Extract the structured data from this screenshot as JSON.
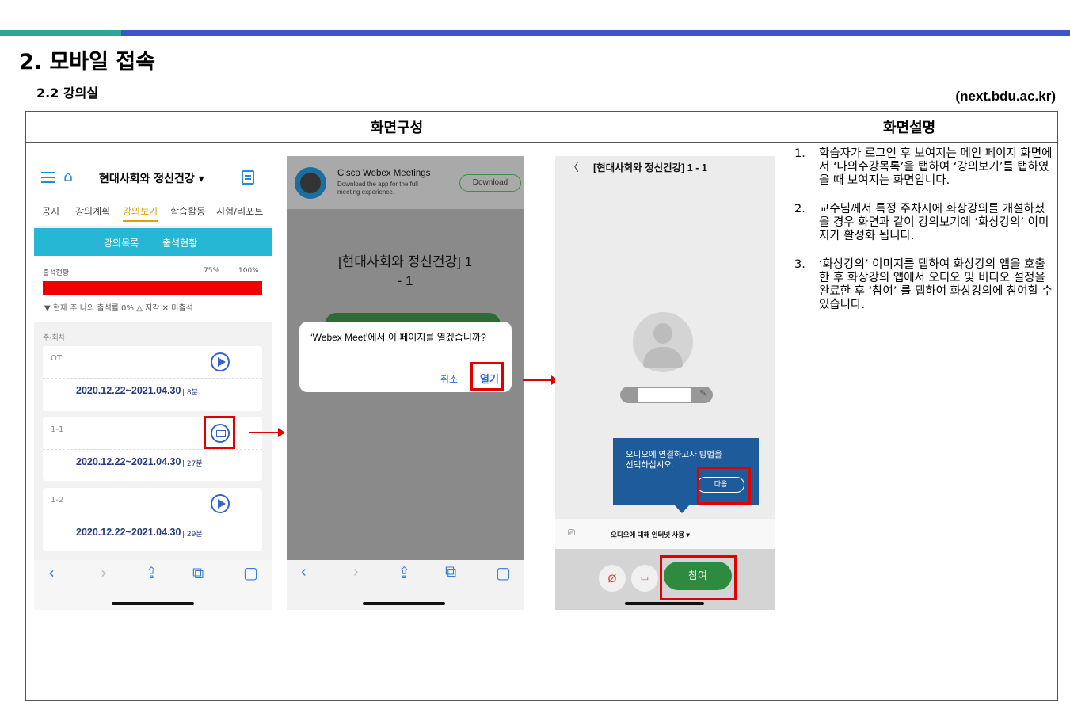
{
  "header": {
    "title": "2. 모바일 접속",
    "subtitle": "2.2 강의실",
    "url": "(next.bdu.ac.kr)"
  },
  "table": {
    "col1_header": "화면구성",
    "col2_header": "화면설명"
  },
  "description": [
    {
      "num": "1.",
      "text": "학습자가 로그인 후 보여지는 메인 페이지 화면에서 ‘나의수강목록’을 탭하여 ‘강의보기’를 탭하였을 때 보여지는 화면입니다."
    },
    {
      "num": "2.",
      "text": "교수님께서 특정 주차시에 화상강의를 개설하셨을 경우 화면과 같이 강의보기에 ‘화상강의’ 이미지가 활성화 됩니다."
    },
    {
      "num": "3.",
      "text": "‘화상강의’ 이미지를 탭하여 화상강의 앱을 호출한 후 화상강의 앱에서 오디오 및 비디오 설정을 완료한 후 ‘참여’ 를 탭하여 화상강의에 참여할 수 있습니다."
    }
  ],
  "phone1": {
    "course": "현대사회와 정신건강 ▾",
    "tabs": [
      "공지",
      "강의계획",
      "강의보기",
      "학습활동",
      "시험/리포트"
    ],
    "active_tab": "강의보기",
    "subtabs": [
      "강의목록",
      "출석현황"
    ],
    "attendance_label": "출석현황",
    "pct75": "75%",
    "pct100": "100%",
    "attendance_fraction": 1.0,
    "legend": "▼ 현재 주   나의 출석률 0%   △ 지각   ✕ 미출석",
    "list_header": "주-회차",
    "rows": [
      {
        "label": "OT",
        "date": "2020.12.22~2021.04.30",
        "dur": "| 8분"
      },
      {
        "label": "1-1",
        "date": "2020.12.22~2021.04.30",
        "dur": "| 27분"
      },
      {
        "label": "1-2",
        "date": "2020.12.22~2021.04.30",
        "dur": "| 29분"
      }
    ],
    "nav": [
      "‹",
      "›",
      "⇪",
      "⧉",
      "▢"
    ]
  },
  "phone2": {
    "banner_title": "Cisco Webex Meetings",
    "banner_sub": "Download the app for the full meeting experience.",
    "download": "Download",
    "meeting_title": "[현대사회와 정신건강] 1",
    "meeting_title2": "- 1",
    "dialog": "‘Webex Meet’에서 이 페이지를 열겠습니까?",
    "cancel": "취소",
    "open": "열기",
    "nav": [
      "‹",
      "›",
      "⇪",
      "⧉",
      "▢"
    ]
  },
  "phone3": {
    "back": "〈",
    "title": "[현대사회와 정신건강]  1 - 1",
    "tooltip1": "오디오에 연결하고자 방법을",
    "tooltip2": "선택하십시오.",
    "next": "다음",
    "audio": "오디오에 대해 인터넷 사용 ▾",
    "join": "참여"
  }
}
